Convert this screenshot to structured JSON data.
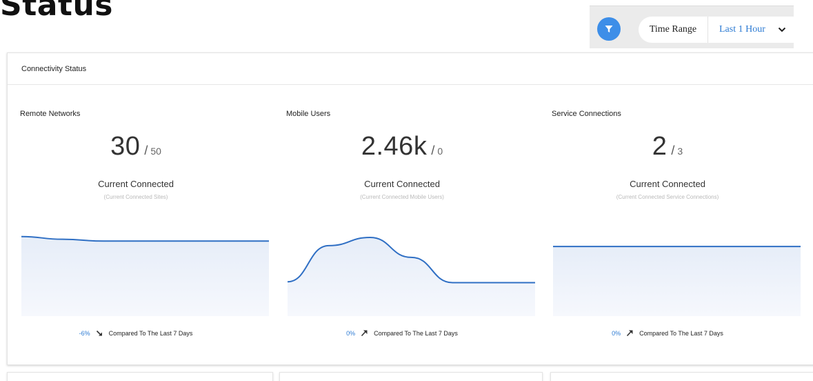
{
  "page": {
    "title": "Status"
  },
  "filter_bar": {
    "filter_icon": "filter-icon",
    "time_range_label": "Time Range",
    "time_range_value": "Last 1 Hour",
    "chevron_icon": "chevron-down-icon",
    "accent": "#3d8ee8"
  },
  "connectivity": {
    "title": "Connectivity Status",
    "line_color": "#2f6fc4",
    "fill_color": "#e6edf8",
    "panels": [
      {
        "title": "Remote Networks",
        "current": "30",
        "separator": "/",
        "total": "50",
        "label": "Current Connected",
        "sublabel": "(Current Connected Sites)",
        "change": "-6%",
        "trend": "down",
        "compare_text": "Compared To The Last 7 Days",
        "trend_values": [
          0.88,
          0.85,
          0.83,
          0.83,
          0.83,
          0.83,
          0.83
        ]
      },
      {
        "title": "Mobile Users",
        "current": "2.46k",
        "separator": "/",
        "total": "0",
        "label": "Current Connected",
        "sublabel": "(Current Connected Mobile Users)",
        "change": "0%",
        "trend": "up",
        "compare_text": "Compared To The Last 7 Days",
        "trend_values": [
          0.38,
          0.78,
          0.87,
          0.65,
          0.37,
          0.37,
          0.37
        ]
      },
      {
        "title": "Service Connections",
        "current": "2",
        "separator": "/",
        "total": "3",
        "label": "Current Connected",
        "sublabel": "(Current Connected Service Connections)",
        "change": "0%",
        "trend": "up",
        "compare_text": "Compared To The Last 7 Days",
        "trend_values": [
          0.77,
          0.77,
          0.77,
          0.77,
          0.77,
          0.77,
          0.77
        ]
      }
    ]
  }
}
